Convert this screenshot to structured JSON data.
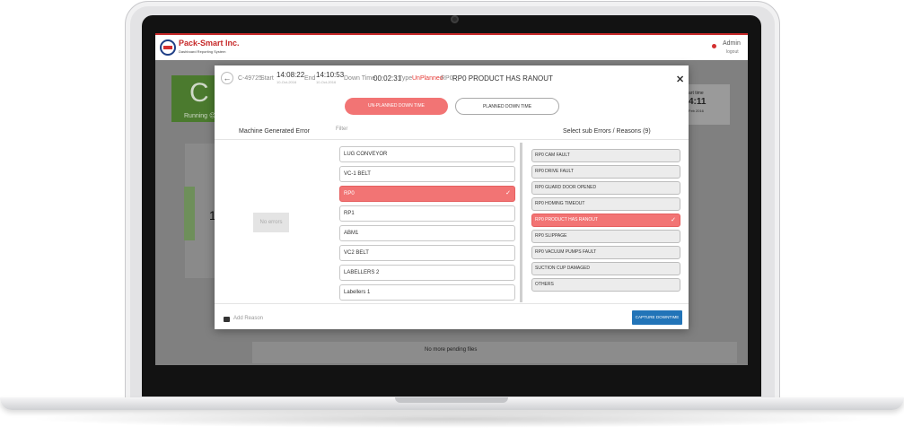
{
  "app": {
    "brand_title": "Pack-Smart Inc.",
    "brand_subtitle": "Dashboard Reporting System",
    "user_name": "Admin",
    "logout_label": "logout",
    "status_letter": "C",
    "status_label": "Running ☹",
    "side_value": "1",
    "right_time_label": "art time",
    "right_time": "4:11",
    "right_date": "Feb 2016",
    "pending_text": "No more pending files"
  },
  "modal": {
    "job_id": "C-49725",
    "start_label": "Start",
    "start_time": "14:08:22",
    "start_date": "10-Oct-2016",
    "end_label": "End",
    "end_time": "14:10:53",
    "end_date": "10-Oct-2016",
    "down_time_label": "Down Time",
    "down_time_value": "00:02:31",
    "type_label": "Type",
    "type_value": "UnPlanned",
    "code": "RP0",
    "title": "RP0 PRODUCT HAS RANOUT",
    "tabs": [
      {
        "label": "UN-PLANNED DOWN TIME",
        "active": true
      },
      {
        "label": "PLANNED DOWN TIME",
        "active": false
      }
    ],
    "machine_error_title": "Machine Generated Error",
    "filter_label": "Filter",
    "sub_errors_title": "Select sub Errors / Reasons (9)",
    "no_errors": "No errors",
    "machines": [
      {
        "label": "LUG CONVEYOR",
        "selected": false
      },
      {
        "label": "VC-1 BELT",
        "selected": false
      },
      {
        "label": "RP0",
        "selected": true
      },
      {
        "label": "RP1",
        "selected": false
      },
      {
        "label": "ABM1",
        "selected": false
      },
      {
        "label": "VC2 BELT",
        "selected": false
      },
      {
        "label": "LABELLERS 2",
        "selected": false
      },
      {
        "label": "Labellers 1",
        "selected": false
      }
    ],
    "reasons": [
      {
        "label": "RP0 CAM FAULT",
        "selected": false
      },
      {
        "label": "RP0 DRIVE FAULT",
        "selected": false
      },
      {
        "label": "RP0 GUARD DOOR OPENED",
        "selected": false
      },
      {
        "label": "RP0 HOMING TIMEOUT",
        "selected": false
      },
      {
        "label": "RP0 PRODUCT HAS RANOUT",
        "selected": true
      },
      {
        "label": "RP0 SLIPPAGE",
        "selected": false
      },
      {
        "label": "RP0 VACUUM PUMPS FAULT",
        "selected": false
      },
      {
        "label": "SUCTION CUP DAMAGED",
        "selected": false
      },
      {
        "label": "OTHERS",
        "selected": false
      }
    ],
    "add_reason_label": "Add Reason",
    "capture_label": "CAPTURE DOWNTIME",
    "check_glyph": "✓",
    "back_glyph": "←",
    "close_glyph": "✕"
  }
}
